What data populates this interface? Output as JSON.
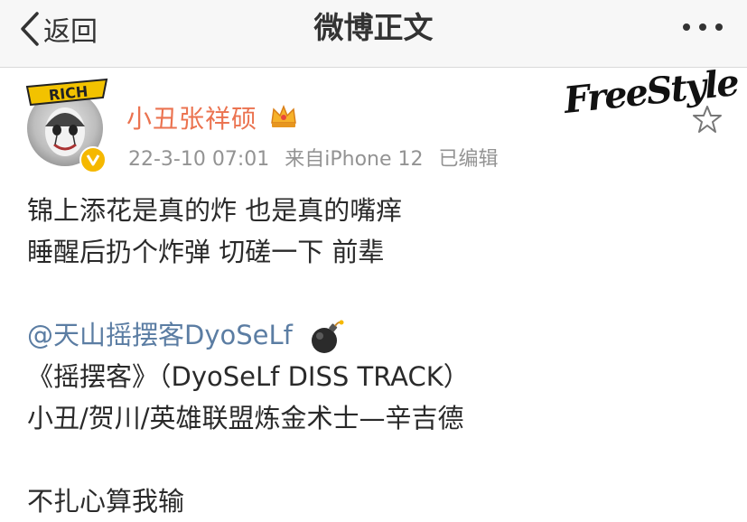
{
  "nav": {
    "back_label": "返回",
    "title": "微博正文"
  },
  "user": {
    "name": "小丑张祥硕",
    "avatar_badge_text": "RICH",
    "timestamp": "22-3-10 07:01",
    "source": "来自iPhone 12",
    "edited": "已编辑"
  },
  "sticker": {
    "text": "FreeStyle"
  },
  "post": {
    "line1": "锦上添花是真的炸 也是真的嘴痒",
    "line2": "睡醒后扔个炸弹 切磋一下 前辈",
    "mention": "@天山摇摆客DyoSeLf",
    "line4": "《摇摆客》（DyoSeLf DISS TRACK）",
    "line5": "小丑/贺川/英雄联盟炼金术士—辛吉德",
    "line6": "不扎心算我输"
  },
  "colors": {
    "username": "#eb7350",
    "mention": "#5b7da3",
    "meta": "#939393",
    "verified": "#f5b800"
  },
  "icons": [
    "chevron-left-icon",
    "more-dots-icon",
    "crown-icon",
    "verified-icon",
    "star-icon",
    "bomb-icon"
  ]
}
